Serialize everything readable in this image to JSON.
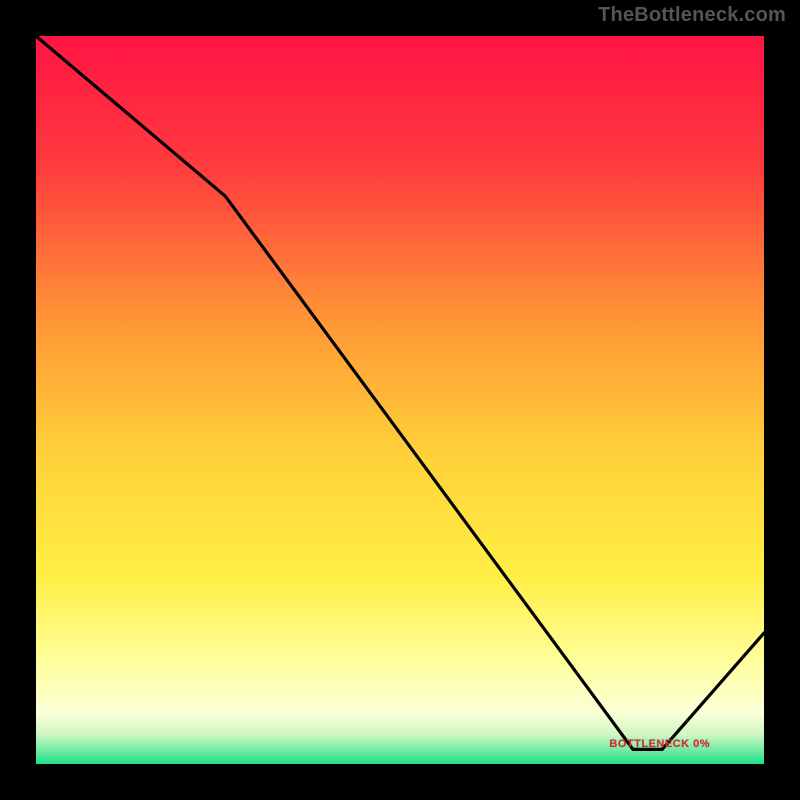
{
  "attribution": "TheBottleneck.com",
  "floor_label": "BOTTLENECK 0%",
  "chart_data": {
    "type": "line",
    "title": "",
    "xlabel": "",
    "ylabel": "",
    "xlim": [
      0,
      100
    ],
    "ylim": [
      0,
      100
    ],
    "background_gradient": {
      "top": "#ff1846",
      "upper_mid": "#ffa23c",
      "mid": "#ffe03a",
      "lower_mid": "#ffff9c",
      "bottom": "#1de28c"
    },
    "series": [
      {
        "name": "bottleneck-curve",
        "x": [
          0,
          26,
          82,
          86,
          100
        ],
        "y": [
          100,
          78,
          2,
          2,
          18
        ]
      }
    ],
    "floor_region": {
      "x_start": 80,
      "x_end": 88,
      "y": 2
    }
  }
}
